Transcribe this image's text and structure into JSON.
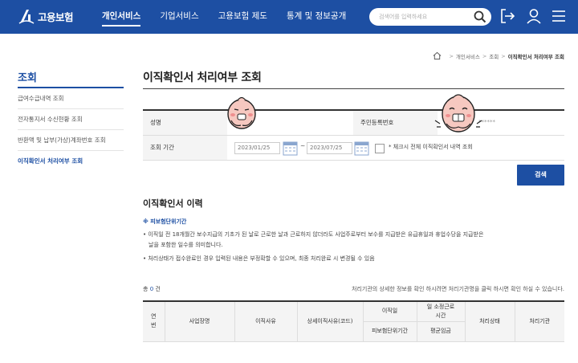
{
  "header": {
    "logo_text": "고용보험",
    "nav": [
      {
        "label": "개인서비스"
      },
      {
        "label": "기업서비스"
      },
      {
        "label": "고용보험 제도"
      },
      {
        "label": "통계 및 정보공개"
      }
    ],
    "search_placeholder": "검색어를 입력하세요"
  },
  "breadcrumb": {
    "items": [
      {
        "label": "개인서비스"
      },
      {
        "label": "조회"
      },
      {
        "label": "이직확인서 처리여부 조회"
      }
    ]
  },
  "sidebar": {
    "title": "조회",
    "items": [
      {
        "label": "급여수급내역 조회"
      },
      {
        "label": "전자통지서 수신현황 조회"
      },
      {
        "label": "반환액 및 납부(가상)계좌번호 조회"
      },
      {
        "label": "이직확인서 처리여부 조회"
      }
    ]
  },
  "page_title": "이직확인서 처리여부 조회",
  "form": {
    "name_label": "성명",
    "rrn_label": "주민등록번호",
    "rrn_masked": "******",
    "period_label": "조회 기간",
    "date_from": "2023/01/25",
    "date_to": "2023/07/25",
    "tilde": "~",
    "checkbox_label": "* 체크시 전체 이직확인서 내역 조회"
  },
  "search_button": "검색",
  "history": {
    "title": "이직확인서 이력",
    "note_title": "※ 피보험단위기간",
    "bullets": [
      "• 이직일 전 18개월간 보수지급의 기초가 된 날로 근로한 날과 근로하지 않더라도 사업주로부터 보수를 지급받은 유급휴일과 휴업수당을 지급받은",
      "날을 포함한 일수를 의미합니다.",
      "• 처리상태가 접수완료인 경우 입력된 내용은 부정확할 수 있으며, 최종 처리완료 시 변경될 수 있음"
    ]
  },
  "table": {
    "count_prefix": "총",
    "count_value": "0",
    "count_suffix": "건",
    "note": "처리기관의 상세한 정보를 확인 하시려면 처리기관명을 클릭 하시면 확인 하실 수 있습니다.",
    "headers": {
      "no_1": "연",
      "no_2": "번",
      "company": "사업장명",
      "reason": "이직사유",
      "detail_reason": "상세이직사유(코드)",
      "leave_date": "이직일",
      "insured_period": "피보험단위기간",
      "work_hours_1": "일 소정근로",
      "work_hours_2": "시간",
      "avg_wage": "평균임금",
      "status": "처리상태",
      "agency": "처리기관"
    }
  },
  "colors": {
    "brand": "#1d4fa3",
    "header_bg": "#1d4fa3"
  }
}
